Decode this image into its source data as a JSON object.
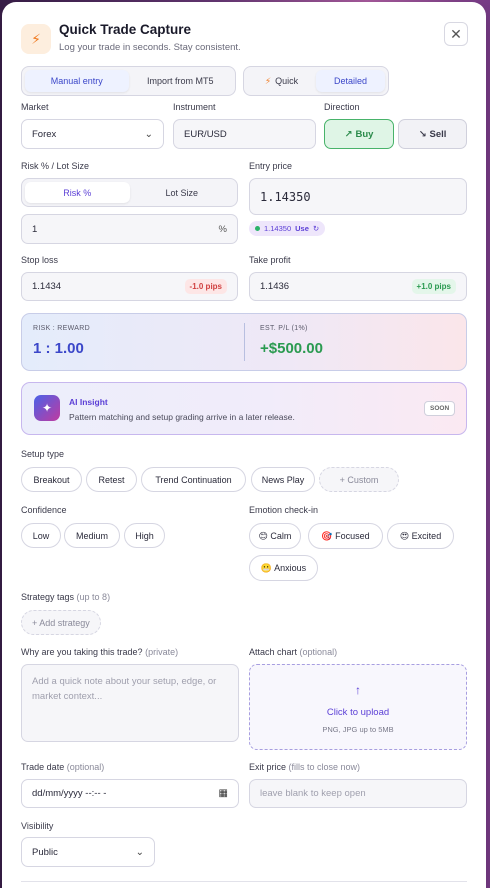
{
  "header": {
    "title": "Quick Trade Capture",
    "subtitle": "Log your trade in seconds. Stay consistent.",
    "icon": "bolt-icon",
    "close_icon": "close-icon"
  },
  "mode_tabs": [
    "Manual entry",
    "Import from MT5"
  ],
  "detail_tabs": {
    "quick": "Quick",
    "detailed": "Detailed"
  },
  "market": {
    "label": "Market",
    "value": "Forex"
  },
  "instrument": {
    "label": "Instrument",
    "value": "EUR/USD"
  },
  "direction": {
    "label": "Direction",
    "buy": "Buy",
    "sell": "Sell"
  },
  "risk": {
    "label": "Risk % / Lot Size",
    "tabs": [
      "Risk %",
      "Lot Size"
    ],
    "value": "1",
    "unit": "%"
  },
  "entry": {
    "label": "Entry price",
    "value": "1.14350",
    "chip_price": "1.14350",
    "chip_use": "Use"
  },
  "stop_loss": {
    "label": "Stop loss",
    "value": "1.1434",
    "pips": "-1.0 pips"
  },
  "take_profit": {
    "label": "Take profit",
    "value": "1.1436",
    "pips": "+1.0 pips"
  },
  "rr": {
    "rr_label": "RISK : REWARD",
    "rr_value": "1 : 1.00",
    "pl_label": "EST. P/L (1%)",
    "pl_value": "+$500.00"
  },
  "ai": {
    "title": "AI Insight",
    "text": "Pattern matching and setup grading arrive in a later release.",
    "badge": "SOON"
  },
  "setup": {
    "label": "Setup type",
    "options": [
      "Breakout",
      "Retest",
      "Trend Continuation",
      "News Play",
      "+ Custom"
    ]
  },
  "confidence": {
    "label": "Confidence",
    "options": [
      "Low",
      "Medium",
      "High"
    ]
  },
  "emotion": {
    "label": "Emotion check-in",
    "options": [
      "😊 Calm",
      "🎯 Focused",
      "😍 Excited",
      "😬 Anxious"
    ]
  },
  "tags": {
    "label": "Strategy tags",
    "hint": "(up to 8)",
    "add": "+ Add strategy"
  },
  "reason": {
    "label": "Why are you taking this trade?",
    "hint": "(private)",
    "placeholder": "Add a quick note about your setup, edge, or market context..."
  },
  "attach": {
    "label": "Attach chart",
    "hint": "(optional)",
    "cta": "Click to upload",
    "sub": "PNG, JPG up to 5MB"
  },
  "trade_date": {
    "label": "Trade date",
    "hint": "(optional)",
    "value": "dd/mm/yyyy --:-- -"
  },
  "exit_price": {
    "label": "Exit price",
    "hint": "(fills to close now)",
    "placeholder": "leave blank to keep open"
  },
  "visibility": {
    "label": "Visibility",
    "value": "Public"
  }
}
